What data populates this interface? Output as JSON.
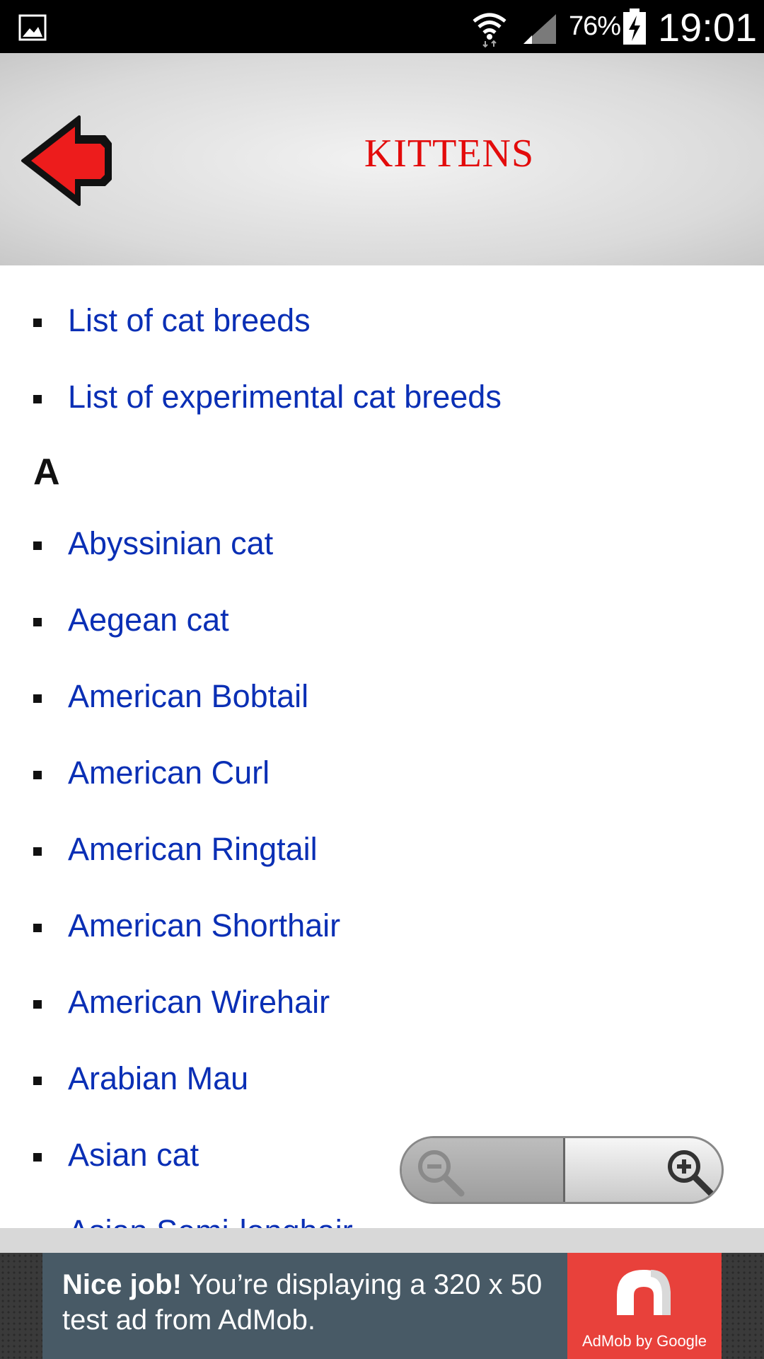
{
  "status_bar": {
    "battery_percent": "76%",
    "time": "19:01"
  },
  "header": {
    "title": "KITTENS"
  },
  "list": {
    "top_links": [
      "List of cat breeds",
      "List of experimental cat breeds"
    ],
    "section_letter": "A",
    "breeds": [
      "Abyssinian cat",
      "Aegean cat",
      "American Bobtail",
      "American Curl",
      "American Ringtail",
      "American Shorthair",
      "American Wirehair",
      "Arabian Mau",
      "Asian cat",
      "Asian Semi-longhair"
    ]
  },
  "ad": {
    "headline": "Nice job!",
    "body": " You’re displaying a 320 x 50 test ad from AdMob.",
    "brand": "AdMob by Google"
  },
  "colors": {
    "link": "#0a2fb5",
    "title": "#e30b0b",
    "ad_background": "#485a66",
    "ad_logo": "#e8413b"
  }
}
